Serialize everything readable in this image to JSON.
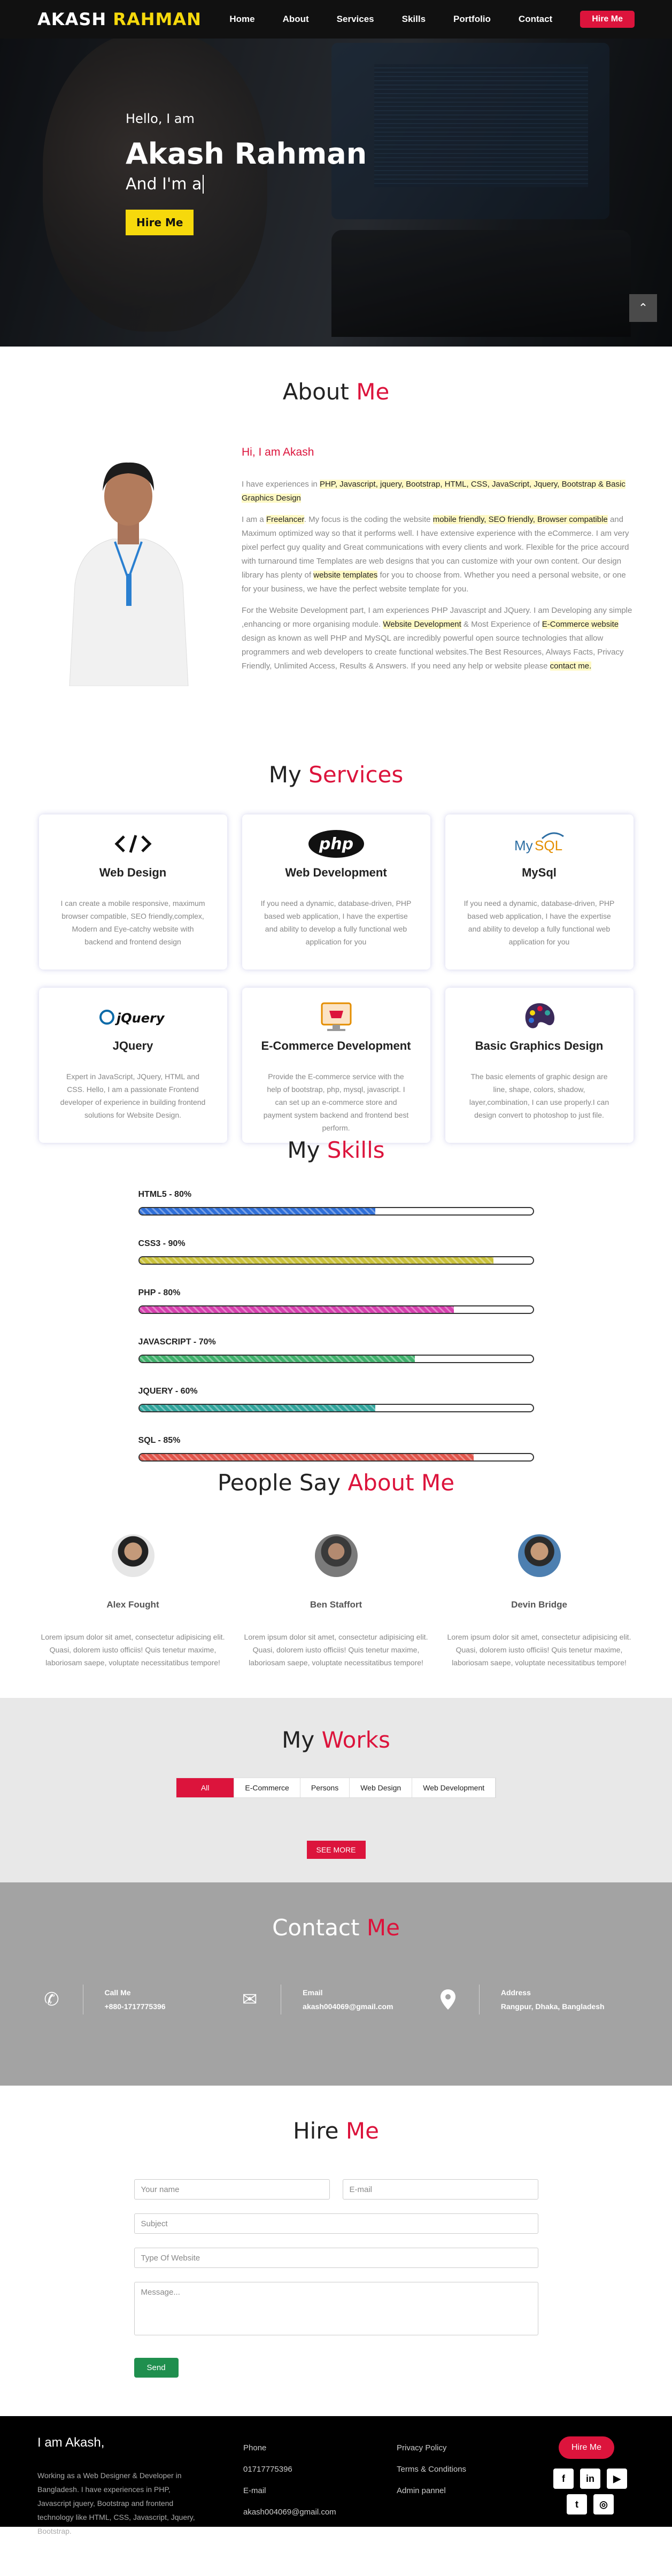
{
  "nav": {
    "logo_first": "AKASH",
    "logo_second": "RAHMAN",
    "links": [
      "Home",
      "About",
      "Services",
      "Skills",
      "Portfolio",
      "Contact"
    ],
    "hire_label": "Hire Me"
  },
  "hero": {
    "hello": "Hello, I am",
    "name": "Akash Rahman",
    "sub": "And I'm a",
    "button": "Hire Me"
  },
  "about": {
    "title": "About",
    "title_accent": "Me",
    "greeting": "Hi, I am Akash",
    "p1_prefix": "I have experiences in",
    "p1_highlight": "PHP, Javascript, jquery, Bootstrap, HTML, CSS, JavaScript, Jquery, Bootstrap & Basic Graphics Design",
    "p2_a": "I am a",
    "p2_hl1": "Freelancer",
    "p2_b": ". My focus is the coding the website",
    "p2_hl2": "mobile friendly, SEO friendly, Browser compatible",
    "p2_c": "and Maximum optimized way so that it performs well. I have extensive experience with the eCommerce. I am very pixel perfect guy quality and Great communications with every clients and work. Flexible for the price accourd with turnaround time Templates are web designs that you can customize with your own content. Our design library has plenty of",
    "p2_hl3": "website templates",
    "p2_d": "for you to choose from. Whether you need a personal website, or one for your business, we have the perfect website template for you.",
    "p3_a": "For the Website Development part, I am experiences PHP Javascript and JQuery. I am Developing any simple ,enhancing or more organising module.",
    "p3_hl1": "Website Development",
    "p3_b": "& Most Experience of",
    "p3_hl2": "E-Commerce website",
    "p3_c": "design as known as well PHP and MySQL are incredibly powerful open source technologies that allow programmers and web developers to create functional websites.The Best Resources, Always Facts, Privacy Friendly, Unlimited Access, Results & Answers. If you need any help or website please",
    "p3_hl3": "contact me."
  },
  "services": {
    "title": "My",
    "title_accent": "Services",
    "items": [
      {
        "icon": "code-icon",
        "title": "Web Design",
        "text": "I can create a mobile responsive, maximum browser compatible, SEO friendly,complex, Modern and Eye-catchy website with backend and frontend design"
      },
      {
        "icon": "php-logo-icon",
        "title": "Web Development",
        "text": "If you need a dynamic, database-driven, PHP based web application, I have the expertise and ability to develop a fully functional web application for you"
      },
      {
        "icon": "mysql-logo-icon",
        "title": "MySql",
        "text": "If you need a dynamic, database-driven, PHP based web application, I have the expertise and ability to develop a fully functional web application for you"
      },
      {
        "icon": "jquery-logo-icon",
        "title": "JQuery",
        "text": "Expert in JavaScript, JQuery, HTML and CSS. Hello, I am a passionate Frontend developer of experience in building frontend solutions for Website Design."
      },
      {
        "icon": "ecommerce-icon",
        "title": "E-Commerce Development",
        "text": "Provide the E-commerce service with the help of bootstrap, php, mysql, javascript. I can set up an e-commerce store and payment system backend and frontend best perform."
      },
      {
        "icon": "palette-icon",
        "title": "Basic Graphics Design",
        "text": "The basic elements of graphic design are line, shape, colors, shadow, layer,combination, I can use properly.I can design convert to photoshop to just file."
      }
    ]
  },
  "skills": {
    "title": "My",
    "title_accent": "Skills",
    "items": [
      {
        "label": "HTML5 - 80%",
        "value": 60,
        "color": "#2f6fd8"
      },
      {
        "label": "CSS3 - 90%",
        "value": 90,
        "color": "#c9c13a"
      },
      {
        "label": "PHP - 80%",
        "value": 80,
        "color": "#d63fae"
      },
      {
        "label": "JAVASCRIPT - 70%",
        "value": 70,
        "color": "#3fb06b"
      },
      {
        "label": "JQUERY - 60%",
        "value": 60,
        "color": "#2fa39b"
      },
      {
        "label": "SQL - 85%",
        "value": 85,
        "color": "#e2554b"
      }
    ]
  },
  "people": {
    "title": "People Say",
    "title_accent": "About Me",
    "items": [
      {
        "name": "Alex Fought",
        "text": "Lorem ipsum dolor sit amet, consectetur adipisicing elit. Quasi, dolorem iusto officiis! Quis tenetur maxime, laboriosam saepe, voluptate necessitatibus tempore!"
      },
      {
        "name": "Ben Staffort",
        "text": "Lorem ipsum dolor sit amet, consectetur adipisicing elit. Quasi, dolorem iusto officiis! Quis tenetur maxime, laboriosam saepe, voluptate necessitatibus tempore!"
      },
      {
        "name": "Devin Bridge",
        "text": "Lorem ipsum dolor sit amet, consectetur adipisicing elit. Quasi, dolorem iusto officiis! Quis tenetur maxime, laboriosam saepe, voluptate necessitatibus tempore!"
      }
    ]
  },
  "works": {
    "title": "My",
    "title_accent": "Works",
    "filters": [
      "All",
      "E-Commerce",
      "Persons",
      "Web Design",
      "Web Development"
    ],
    "see_more": "SEE MORE"
  },
  "contact": {
    "title": "Contact",
    "title_accent": "Me",
    "items": [
      {
        "icon": "phone-icon",
        "label": "Call Me",
        "value": "+880-1717775396"
      },
      {
        "icon": "envelope-icon",
        "label": "Email",
        "value": "akash004069@gmail.com"
      },
      {
        "icon": "map-pin-icon",
        "label": "Address",
        "value": "Rangpur, Dhaka, Bangladesh"
      }
    ]
  },
  "hire": {
    "title": "Hire",
    "title_accent": "Me",
    "name_ph": "Your name",
    "email_ph": "E-mail",
    "subject_ph": "Subject",
    "type_ph": "Type Of Website",
    "message_ph": "Message...",
    "send": "Send"
  },
  "footer": {
    "heading": "I am Akash,",
    "text": "Working as a Web Designer & Developer in Bangladesh. I have experiences in PHP, Javascript jquery, Bootstrap and frontend technology like HTML, CSS, Javascript, Jquery, Bootstrap.",
    "phone_label": "Phone",
    "phone": "01717775396",
    "email_label": "E-mail",
    "email": "akash004069@gmail.com",
    "links": [
      "Privacy Policy",
      "Terms & Conditions",
      "Admin pannel"
    ],
    "hire": "Hire Me",
    "social": [
      "f",
      "in",
      "▶",
      "t",
      "◎"
    ]
  }
}
